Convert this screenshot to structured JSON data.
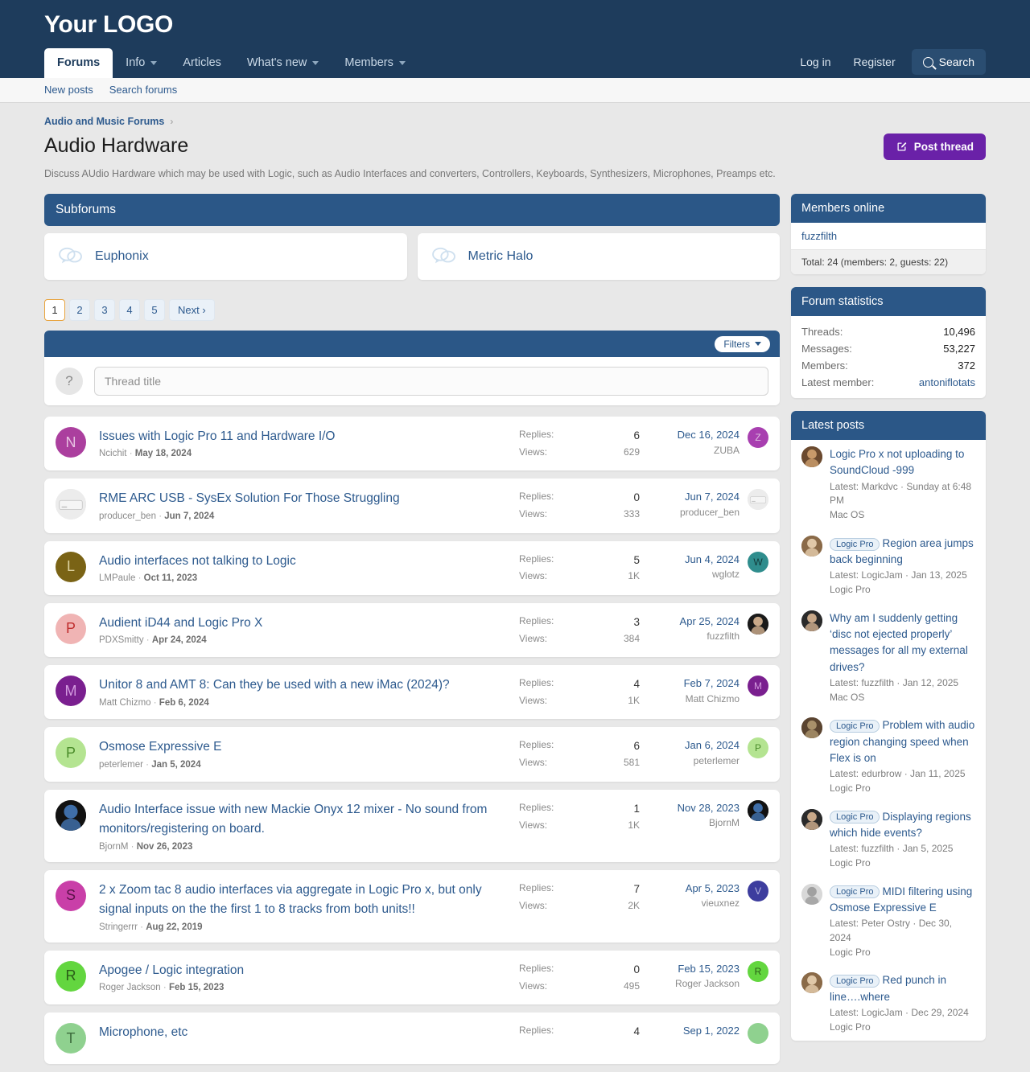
{
  "header": {
    "logo": "Your LOGO",
    "nav": [
      {
        "label": "Forums",
        "has_caret": false,
        "active": true
      },
      {
        "label": "Info",
        "has_caret": true,
        "active": false
      },
      {
        "label": "Articles",
        "has_caret": false,
        "active": false
      },
      {
        "label": "What's new",
        "has_caret": true,
        "active": false
      },
      {
        "label": "Members",
        "has_caret": true,
        "active": false
      }
    ],
    "login": "Log in",
    "register": "Register",
    "search": "Search",
    "subnav": [
      "New posts",
      "Search forums"
    ]
  },
  "breadcrumb": {
    "root": "Audio and Music Forums",
    "sep": "›"
  },
  "page": {
    "title": "Audio Hardware",
    "description": "Discuss AUdio Hardware which may be used with Logic, such as Audio Interfaces and converters, Controllers, Keyboards, Synthesizers, Microphones, Preamps etc.",
    "post_thread": "Post thread"
  },
  "subforums": {
    "header": "Subforums",
    "items": [
      {
        "name": "Euphonix"
      },
      {
        "name": "Metric Halo"
      }
    ]
  },
  "pagination": {
    "pages": [
      "1",
      "2",
      "3",
      "4",
      "5"
    ],
    "current": "1",
    "next": "Next ›"
  },
  "filters": {
    "label": "Filters"
  },
  "search": {
    "placeholder": "Thread title",
    "value": "",
    "help": "?"
  },
  "labels": {
    "replies": "Replies:",
    "views": "Views:"
  },
  "threads": [
    {
      "title": "Issues with Logic Pro 11 and Hardware I/O",
      "author": "Ncichit",
      "date": "May 18, 2024",
      "replies": "6",
      "views": "629",
      "last_date": "Dec 16, 2024",
      "last_user": "ZUBA",
      "avatar": {
        "type": "letter",
        "letter": "N",
        "bg": "#ab3f9e",
        "fg": "#e8c4e3"
      },
      "last_avatar": {
        "type": "letter",
        "letter": "Z",
        "bg": "#a83fb0",
        "fg": "#dcc0e0"
      }
    },
    {
      "title": "RME ARC USB - SysEx Solution For Those Struggling",
      "author": "producer_ben",
      "date": "Jun 7, 2024",
      "replies": "0",
      "views": "333",
      "last_date": "Jun 7, 2024",
      "last_user": "producer_ben",
      "avatar": {
        "type": "photo",
        "bg": "#dcdcdc",
        "fg": "#ffffff"
      },
      "last_avatar": {
        "type": "photo",
        "bg": "#dcdcdc",
        "fg": "#ffffff"
      }
    },
    {
      "title": "Audio interfaces not talking to Logic",
      "author": "LMPaule",
      "date": "Oct 11, 2023",
      "replies": "5",
      "views": "1K",
      "last_date": "Jun 4, 2024",
      "last_user": "wglotz",
      "avatar": {
        "type": "letter",
        "letter": "L",
        "bg": "#7a6315",
        "fg": "#ded3a0"
      },
      "last_avatar": {
        "type": "letter",
        "letter": "W",
        "bg": "#2f8d8d",
        "fg": "#143a3a"
      }
    },
    {
      "title": "Audient iD44 and Logic Pro X",
      "author": "PDXSmitty",
      "date": "Apr 24, 2024",
      "replies": "3",
      "views": "384",
      "last_date": "Apr 25, 2024",
      "last_user": "fuzzfilth",
      "avatar": {
        "type": "letter",
        "letter": "P",
        "bg": "#f0b4b4",
        "fg": "#c03030"
      },
      "last_avatar": {
        "type": "face",
        "bg": "#1a1a1a",
        "fg": "#c8a889"
      }
    },
    {
      "title": "Unitor 8 and AMT 8: Can they be used with a new iMac (2024)?",
      "author": "Matt Chizmo",
      "date": "Feb 6, 2024",
      "replies": "4",
      "views": "1K",
      "last_date": "Feb 7, 2024",
      "last_user": "Matt Chizmo",
      "avatar": {
        "type": "letter",
        "letter": "M",
        "bg": "#7a1f8f",
        "fg": "#d49ce0"
      },
      "last_avatar": {
        "type": "letter",
        "letter": "M",
        "bg": "#7a1f8f",
        "fg": "#d49ce0"
      }
    },
    {
      "title": "Osmose Expressive E",
      "author": "peterlemer",
      "date": "Jan 5, 2024",
      "replies": "6",
      "views": "581",
      "last_date": "Jan 6, 2024",
      "last_user": "peterlemer",
      "avatar": {
        "type": "letter",
        "letter": "P",
        "bg": "#b4e491",
        "fg": "#4a8c2a"
      },
      "last_avatar": {
        "type": "letter",
        "letter": "P",
        "bg": "#b4e491",
        "fg": "#4a8c2a"
      }
    },
    {
      "title": "Audio Interface issue with new Mackie Onyx 12 mixer - No sound from monitors/registering on board.",
      "author": "BjornM",
      "date": "Nov 26, 2023",
      "replies": "1",
      "views": "1K",
      "last_date": "Nov 28, 2023",
      "last_user": "BjornM",
      "avatar": {
        "type": "face",
        "bg": "#121212",
        "fg": "#3f6ea8"
      },
      "last_avatar": {
        "type": "face",
        "bg": "#121212",
        "fg": "#3f6ea8"
      }
    },
    {
      "title": "2 x Zoom tac 8 audio interfaces via aggregate in Logic Pro x, but only signal inputs on the the first 1 to 8 tracks from both units!!",
      "author": "Stringerrr",
      "date": "Aug 22, 2019",
      "replies": "7",
      "views": "2K",
      "last_date": "Apr 5, 2023",
      "last_user": "vieuxnez",
      "avatar": {
        "type": "letter",
        "letter": "S",
        "bg": "#c93fa8",
        "fg": "#5a1248"
      },
      "last_avatar": {
        "type": "letter",
        "letter": "V",
        "bg": "#3d3d9e",
        "fg": "#b8b8e0"
      }
    },
    {
      "title": "Apogee / Logic integration",
      "author": "Roger Jackson",
      "date": "Feb 15, 2023",
      "replies": "0",
      "views": "495",
      "last_date": "Feb 15, 2023",
      "last_user": "Roger Jackson",
      "avatar": {
        "type": "letter",
        "letter": "R",
        "bg": "#63d63f",
        "fg": "#2a5c18"
      },
      "last_avatar": {
        "type": "letter",
        "letter": "R",
        "bg": "#63d63f",
        "fg": "#2a5c18"
      }
    },
    {
      "title": "Microphone, etc",
      "author": "",
      "date": "",
      "replies": "4",
      "views": "",
      "last_date": "Sep 1, 2022",
      "last_user": "",
      "avatar": {
        "type": "letter",
        "letter": "T",
        "bg": "#8fd18f",
        "fg": "#3c6b3c"
      },
      "last_avatar": {
        "type": "letter",
        "letter": "",
        "bg": "#8fd18f",
        "fg": "#3c6b3c"
      }
    }
  ],
  "members_online": {
    "header": "Members online",
    "users": [
      "fuzzfilth"
    ],
    "total": "Total: 24 (members: 2, guests: 22)"
  },
  "forum_stats": {
    "header": "Forum statistics",
    "rows": [
      {
        "key": "Threads:",
        "value": "10,496",
        "link": false
      },
      {
        "key": "Messages:",
        "value": "53,227",
        "link": false
      },
      {
        "key": "Members:",
        "value": "372",
        "link": false
      },
      {
        "key": "Latest member:",
        "value": "antoniflotats",
        "link": true
      }
    ]
  },
  "latest_posts": {
    "header": "Latest posts",
    "items": [
      {
        "tag": "",
        "title": "Logic Pro x not uploading to SoundCloud -999",
        "meta": "Latest: Markdvc · Sunday at 6:48 PM",
        "forum": "Mac OS",
        "avatar": {
          "bg": "#6b4a2f",
          "fg": "#c89a6a"
        }
      },
      {
        "tag": "Logic Pro",
        "title": "Region area jumps back beginning",
        "meta": "Latest: LogicJam · Jan 13, 2025",
        "forum": "Logic Pro",
        "avatar": {
          "bg": "#8a6a48",
          "fg": "#e0c8a8"
        }
      },
      {
        "tag": "",
        "title": "Why am I suddenly getting ‘disc not ejected properly’ messages for all my external drives?",
        "meta": "Latest: fuzzfilth · Jan 12, 2025",
        "forum": "Mac OS",
        "avatar": {
          "bg": "#2a2a2a",
          "fg": "#c8a889"
        }
      },
      {
        "tag": "Logic Pro",
        "title": "Problem with audio region changing speed when Flex is on",
        "meta": "Latest: edurbrow · Jan 11, 2025",
        "forum": "Logic Pro",
        "avatar": {
          "bg": "#5a4430",
          "fg": "#a8906a"
        }
      },
      {
        "tag": "Logic Pro",
        "title": "Displaying regions which hide events?",
        "meta": "Latest: fuzzfilth · Jan 5, 2025",
        "forum": "Logic Pro",
        "avatar": {
          "bg": "#2a2a2a",
          "fg": "#c8a889"
        }
      },
      {
        "tag": "Logic Pro",
        "title": "MIDI filtering using Osmose Expressive E",
        "meta": "Latest: Peter Ostry · Dec 30, 2024",
        "forum": "Logic Pro",
        "avatar": {
          "bg": "#d8d8d8",
          "fg": "#a0a0a0"
        }
      },
      {
        "tag": "Logic Pro",
        "title": "Red punch in line….where",
        "meta": "Latest: LogicJam · Dec 29, 2024",
        "forum": "Logic Pro",
        "avatar": {
          "bg": "#8a6a48",
          "fg": "#e0c8a8"
        }
      }
    ]
  },
  "colors": {
    "brand_dark": "#1e3c5c",
    "block_header": "#2b5787",
    "link": "#2d5a8e",
    "post_button": "#6a21a8",
    "page_bg": "#e8e8e8"
  }
}
